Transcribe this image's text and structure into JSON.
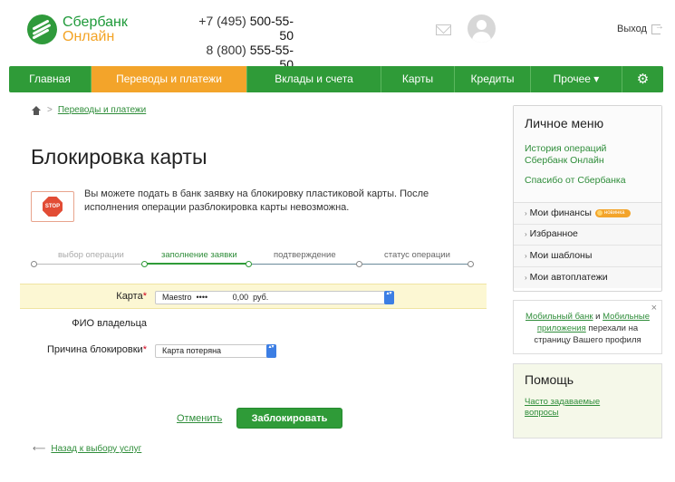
{
  "header": {
    "logo_line1": "Сбербанк",
    "logo_line2": "Онлайн",
    "phone1_prefix": "+7 (495) ",
    "phone1_number": "500-55-50",
    "phone2_prefix": "8 (800) ",
    "phone2_number": "555-55-50",
    "logout_label": "Выход",
    "icons": [
      "mail-icon",
      "avatar",
      "logout-icon"
    ]
  },
  "nav": {
    "items": [
      {
        "label": "Главная"
      },
      {
        "label": "Переводы и платежи"
      },
      {
        "label": "Вклады и счета"
      },
      {
        "label": "Карты"
      },
      {
        "label": "Кредиты"
      },
      {
        "label": "Прочее ▾"
      },
      {
        "label": "⚙"
      }
    ],
    "active_index": 1
  },
  "breadcrumb": {
    "sep": ">",
    "item": "Переводы и платежи"
  },
  "page": {
    "title": "Блокировка карты",
    "stop_text": "STOP",
    "notice": "Вы можете подать в банк заявку на блокировку пластиковой карты. После исполнения операции разблокировка карты невозможна."
  },
  "steps": [
    {
      "label": "выбор операции",
      "state": "done"
    },
    {
      "label": "заполнение заявки",
      "state": "current"
    },
    {
      "label": "подтверждение",
      "state": "pending"
    },
    {
      "label": "статус операции",
      "state": "pending"
    }
  ],
  "form": {
    "card_label": "Карта",
    "required_mark": "*",
    "card_value": "Maestro  ••••           0,00  руб.",
    "owner_label": "ФИО владельца",
    "reason_label": "Причина блокировки",
    "reason_value": "Карта потеряна",
    "select_arrow": "▴▾"
  },
  "actions": {
    "cancel_label": "Отменить",
    "submit_label": "Заблокировать",
    "back_arrow": "⟵",
    "back_label": "Назад к выбору услуг"
  },
  "sidebar": {
    "title": "Личное меню",
    "links": [
      "История операций Сбербанк Онлайн",
      "Спасибо от Сбербанка"
    ],
    "caret": "›",
    "items": [
      {
        "label": "Мои финансы",
        "badge": "новинка"
      },
      {
        "label": "Избранное"
      },
      {
        "label": "Мои шаблоны"
      },
      {
        "label": "Мои автоплатежи"
      }
    ]
  },
  "promo": {
    "close": "×",
    "link1": "Мобильный банк",
    "and": " и ",
    "link2": "Мобильные приложения",
    "text": " перехали на страницу Вашего профиля"
  },
  "help": {
    "title": "Помощь",
    "link": "Часто задаваемые вопросы"
  },
  "colors": {
    "brand_green": "#2f9b38",
    "accent_orange": "#f3a42a",
    "link_green": "#2f8d3a",
    "stop_red": "#e24c35"
  }
}
